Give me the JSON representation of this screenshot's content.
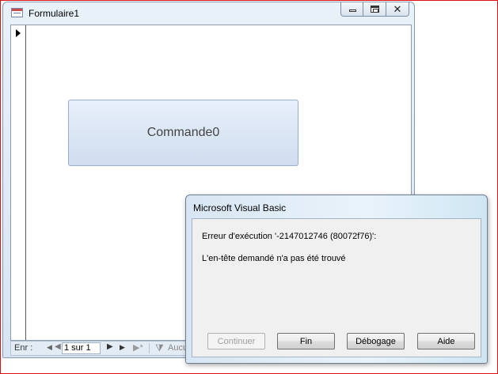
{
  "form_window": {
    "title": "Formulaire1",
    "close_glyph": "✕",
    "command_button_label": "Commande0"
  },
  "nav_bar": {
    "label": "Enr :",
    "first_glyph": "◀",
    "prev_glyph": "◀",
    "current_record": "1 sur 1",
    "next_glyph": "▶",
    "last_glyph": "▶",
    "new_glyph": "▶*",
    "filter_icon": "⧩",
    "filter_label": "Aucu"
  },
  "dialog": {
    "title": "Microsoft Visual Basic",
    "error_code": "Erreur d'exécution '-2147012746 (80072f76)':",
    "error_message": "L'en-tête demandé n'a pas été trouvé",
    "buttons": {
      "continuer": "Continuer",
      "fin": "Fin",
      "debogage": "Débogage",
      "aide": "Aide"
    }
  },
  "colors": {
    "page_frame": "#dd1111",
    "command_button_fill": "#dbe6f4",
    "dialog_body": "#f0f0f0"
  }
}
